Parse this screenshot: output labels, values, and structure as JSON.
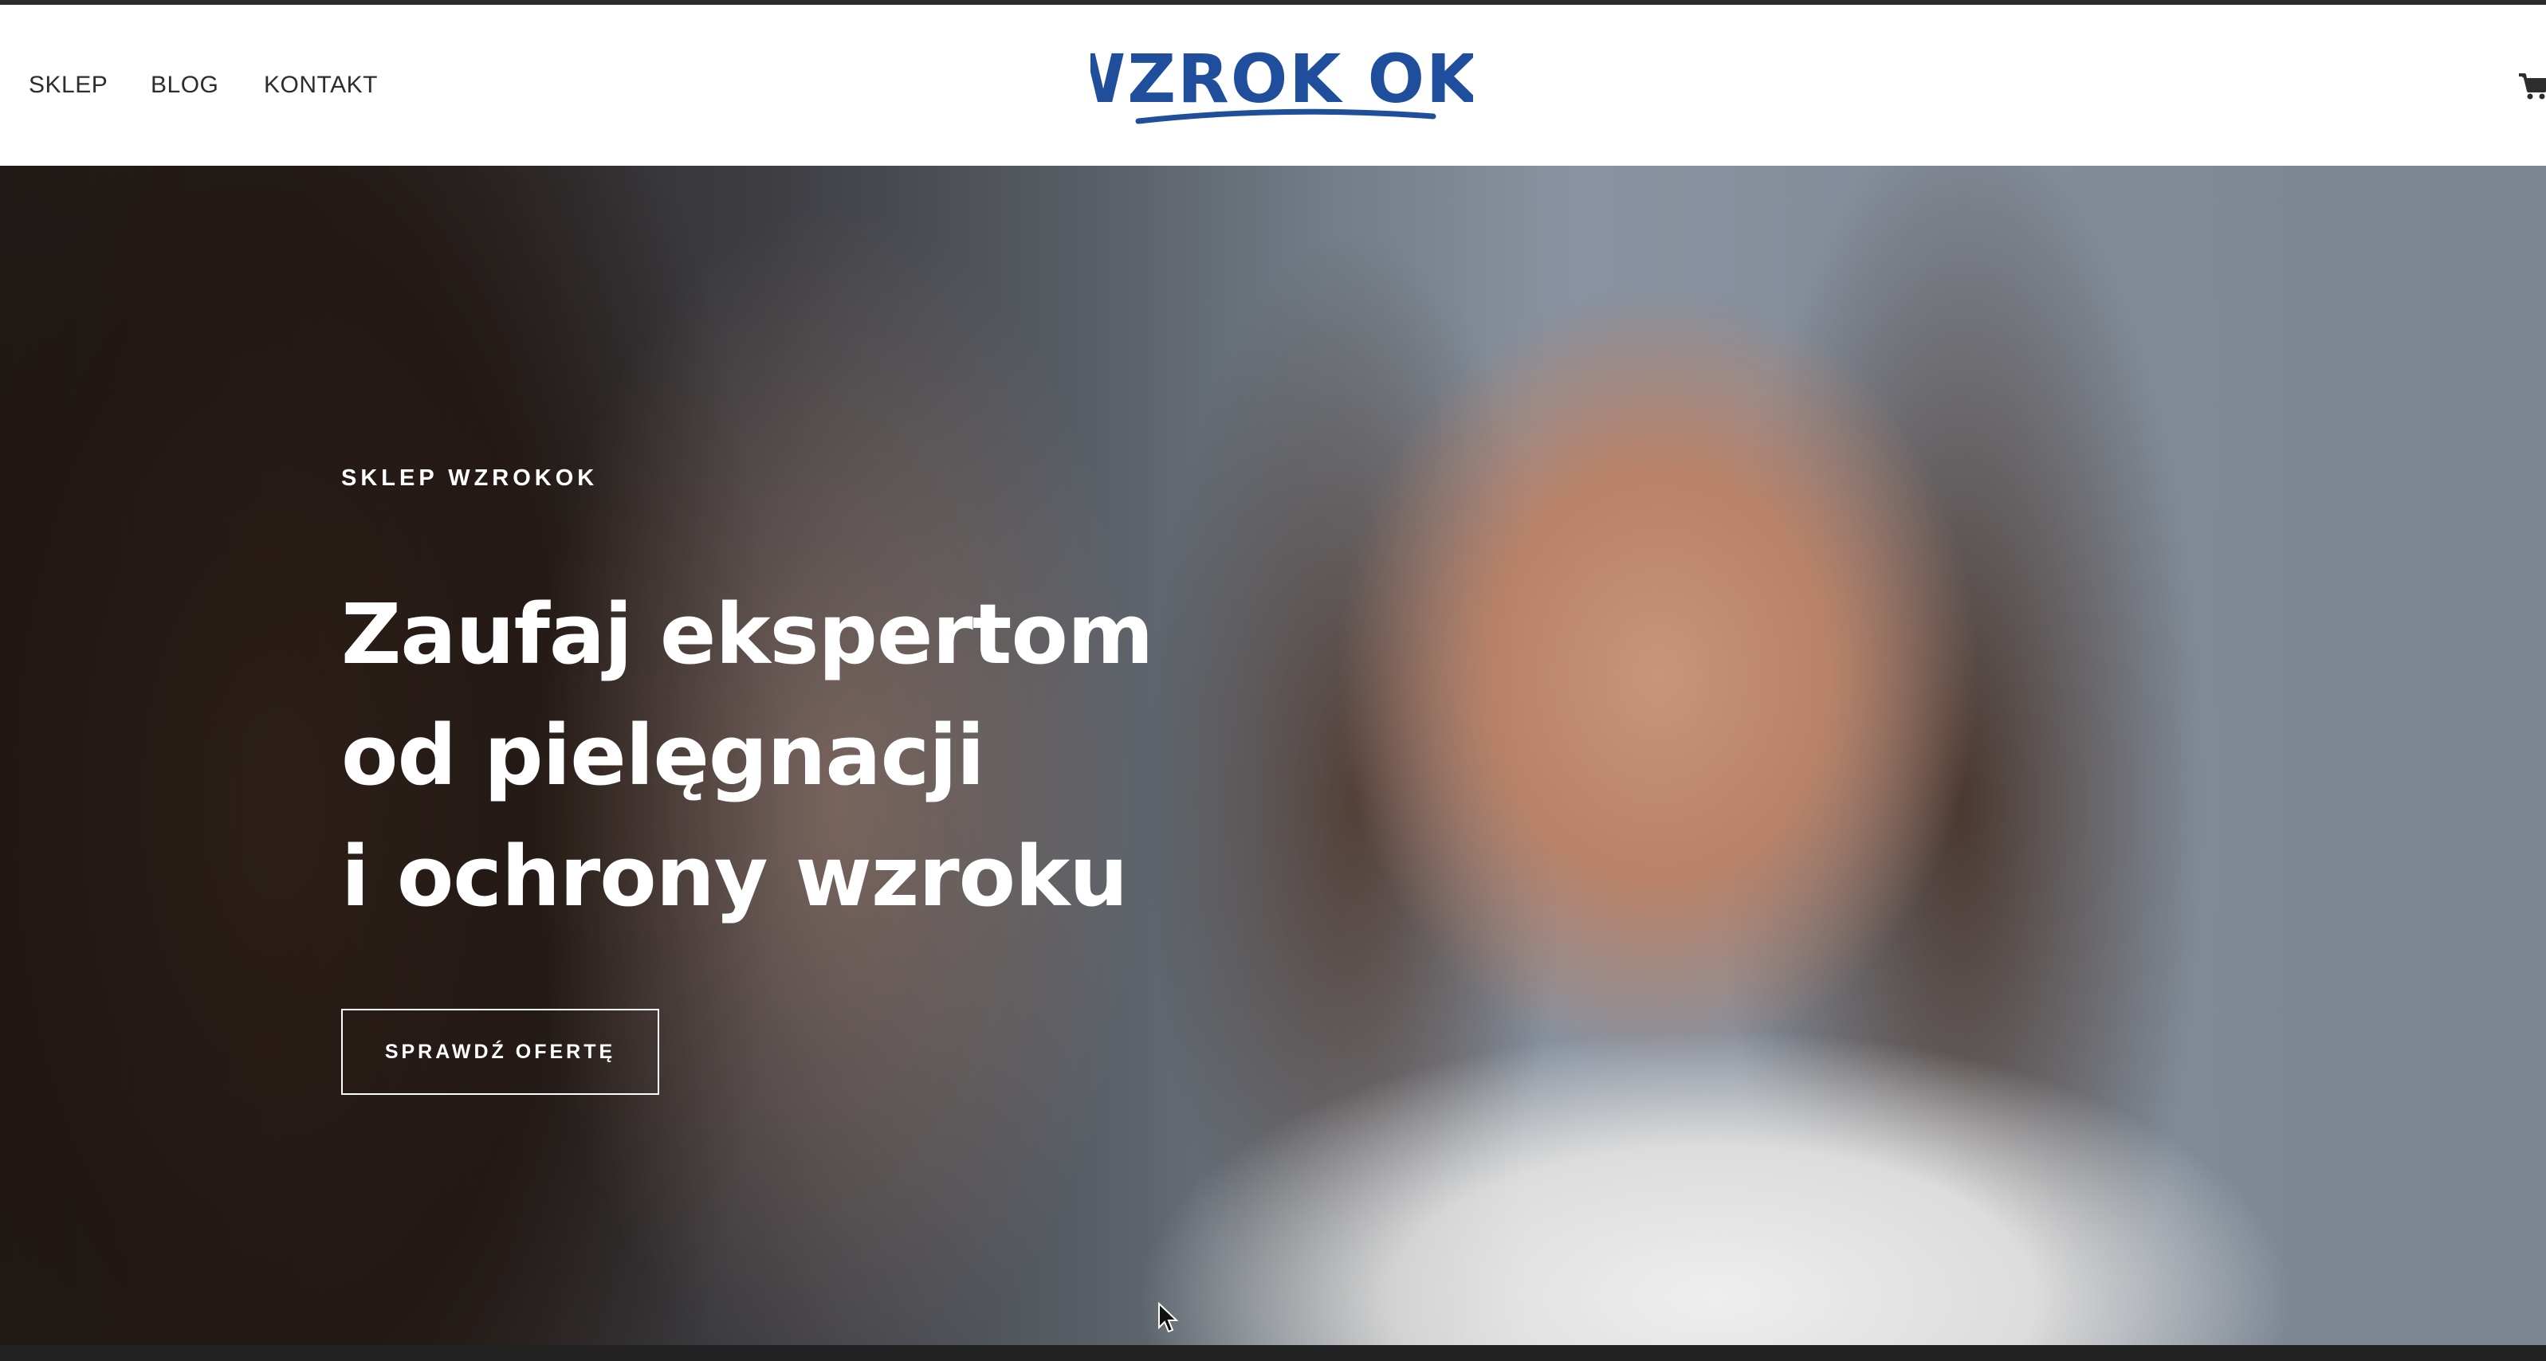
{
  "header": {
    "nav": [
      {
        "label": "SKLEP"
      },
      {
        "label": "BLOG"
      },
      {
        "label": "KONTAKT"
      }
    ],
    "logo_text": "WZROK OK!",
    "cart_icon": "cart-icon"
  },
  "hero": {
    "eyebrow": "SKLEP WZROKOK",
    "headline_lines": [
      "Zaufaj ekspertom",
      "od pielęgnacji",
      "i ochrony wzroku"
    ],
    "cta_label": "SPRAWDŹ OFERTĘ",
    "image_description_icon": "woman-touching-face-photo"
  },
  "colors": {
    "brand_blue": "#1f4e9c",
    "nav_text": "#2d2d2d",
    "hero_text": "#ffffff"
  }
}
